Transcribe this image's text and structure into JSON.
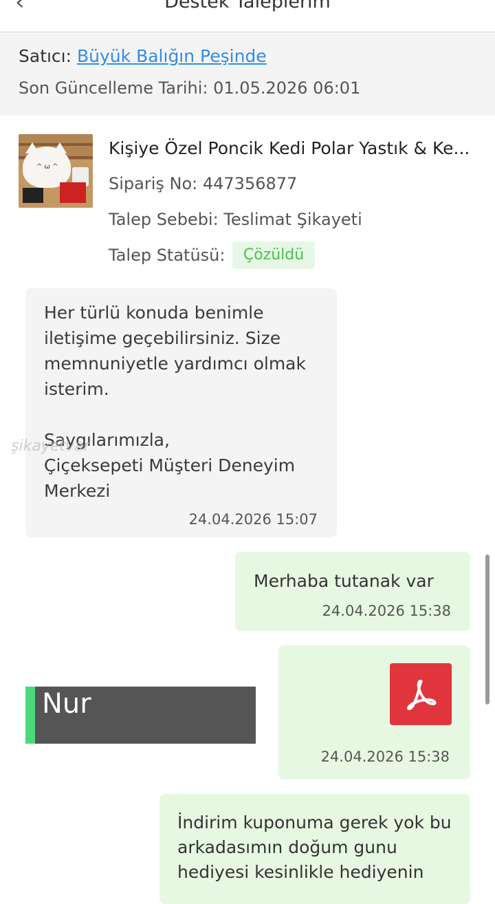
{
  "header": {
    "title": "Destek Taleplerim",
    "back_icon": "chevron-left-icon"
  },
  "seller": {
    "label": "Satıcı:",
    "name": "Büyük Balığın Peşinde",
    "last_update": "Son Güncelleme Tarihi: 01.05.2026 06:01"
  },
  "product": {
    "title": "Kişiye Özel Poncik Kedi Polar Yastık & Ke...",
    "order_no": "Sipariş No: 447356877",
    "reason": "Talep Sebebi: Teslimat Şikayeti",
    "status_label": "Talep Statüsü:",
    "status": "Çözüldü",
    "status_color": "#4bbf4b"
  },
  "messages": [
    {
      "text": "Her türlü konuda benimle iletişime geçebilirsiniz. Size memnuniyetle yardımcı olmak isterim.\n\nSaygılarımızla,\nÇiçeksepeti Müşteri Deneyim Merkezi",
      "time": "24.04.2026 15:07"
    },
    {
      "text": "Merhaba tutanak var",
      "time": "24.04.2026 15:38"
    },
    {
      "attachment_icon": "pdf-file-icon",
      "time": "24.04.2026 15:38"
    },
    {
      "text": "İndirim kuponuma gerek yok bu arkadasımın doğum gunu hediyesi kesinlikle hediyenin"
    }
  ],
  "overlay": {
    "name": "Nur"
  },
  "watermark": "şikayetvar"
}
